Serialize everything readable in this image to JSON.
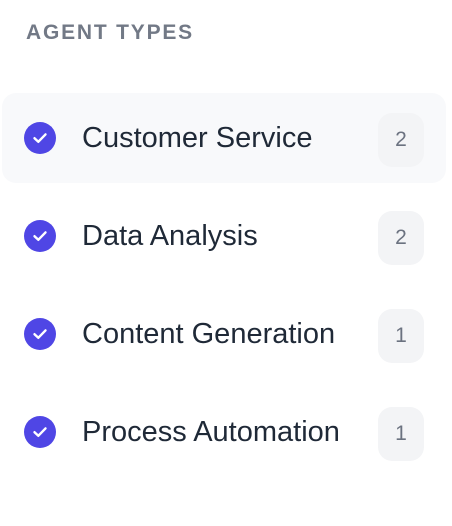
{
  "filter_section": {
    "title": "AGENT TYPES",
    "items": [
      {
        "label": "Customer Service",
        "count": "2",
        "checked": true,
        "active": true
      },
      {
        "label": "Data Analysis",
        "count": "2",
        "checked": true,
        "active": false
      },
      {
        "label": "Content Generation",
        "count": "1",
        "checked": true,
        "active": false
      },
      {
        "label": "Process Automation",
        "count": "1",
        "checked": true,
        "active": false
      }
    ]
  },
  "colors": {
    "accent": "#4f46e5",
    "title_text": "#727986",
    "item_text": "#1f2937",
    "count_background": "#f3f4f6",
    "active_row_background": "#f8f9fb"
  },
  "icons": {
    "check": "check-circle-icon"
  }
}
